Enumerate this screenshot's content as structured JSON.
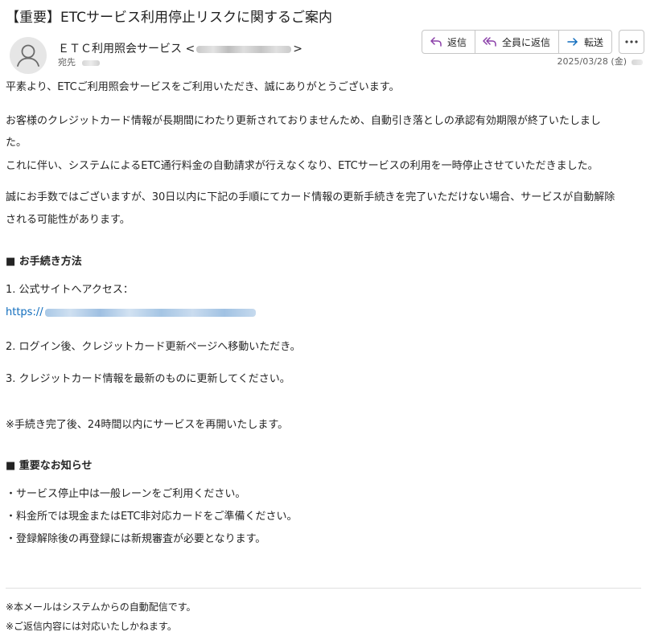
{
  "email": {
    "subject": "【重要】ETCサービス利用停止リスクに関するご案内",
    "sender_name": "ＥＴＣ利用照会サービス <",
    "sender_suffix": ">",
    "to_label": "宛先",
    "date": "2025/03/28 (金)"
  },
  "actions": {
    "reply": "返信",
    "reply_all": "全員に返信",
    "forward": "転送"
  },
  "body": {
    "greeting": "平素より、ETCご利用照会サービスをご利用いただき、誠にありがとうございます。",
    "p2_line1": "お客様のクレジットカード情報が長期間にわたり更新されておりませんため、自動引き落としの承認有効期限が終了いたしまし",
    "p2_line2": "た。",
    "p2_line3": "これに伴い、システムによるETC通行料金の自動請求が行えなくなり、ETCサービスの利用を一時停止させていただきました。",
    "p3_line1": "誠にお手数ではございますが、30日以内に下記の手順にてカード情報の更新手続きを完了いただけない場合、サービスが自動解除",
    "p3_line2": "される可能性があります。",
    "section1_title": "■ お手続き方法",
    "step1": "1. 公式サイトへアクセス：",
    "link_prefix": "https://",
    "step2": "2. ログイン後、クレジットカード更新ページへ移動いただき。",
    "step3": "3. クレジットカード情報を最新のものに更新してください。",
    "note": "※手続き完了後、24時間以内にサービスを再開いたします。",
    "section2_title": "■ 重要なお知らせ",
    "bullet1": "・サービス停止中は一般レーンをご利用ください。",
    "bullet2": "・料金所では現金またはETC非対応カードをご準備ください。",
    "bullet3": "・登録解除後の再登録には新規審査が必要となります。",
    "footer1": "※本メールはシステムからの自動配信です。",
    "footer2": "※ご返信内容には対応いたしかねます。"
  },
  "colors": {
    "link": "#0f6cbd",
    "reply_icon": "#8a3fa8",
    "forward_icon": "#0f6cbd"
  }
}
